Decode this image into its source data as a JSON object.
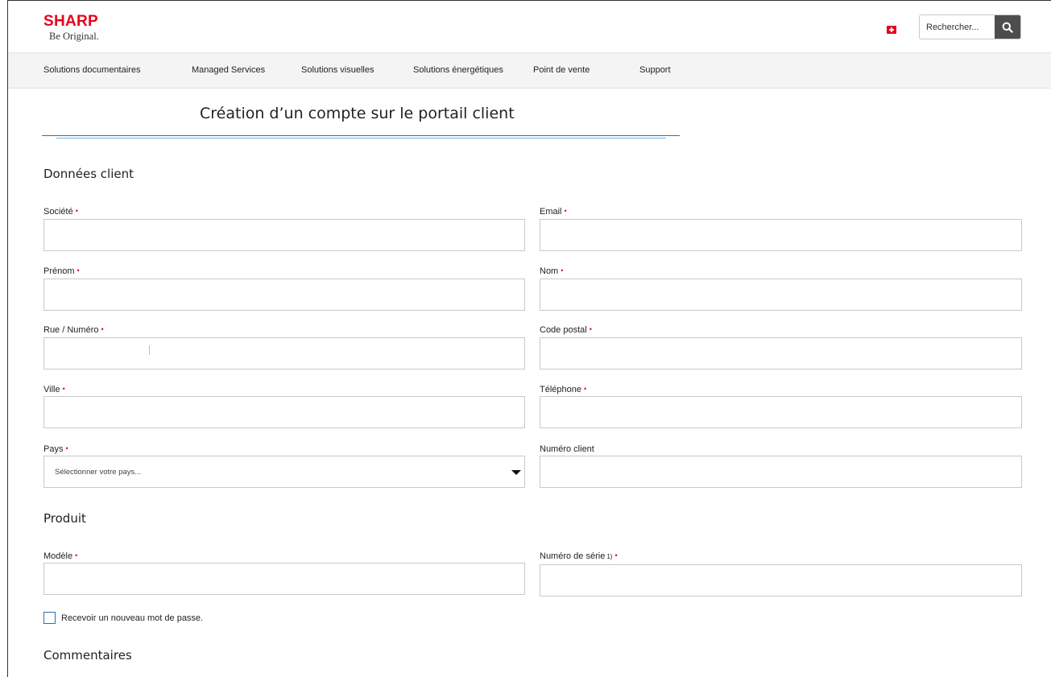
{
  "header": {
    "logo_mark": "SHARP",
    "logo_tagline": "Be Original.",
    "flag": "swiss-flag-icon",
    "search": {
      "placeholder": "Rechercher...",
      "icon": "search-icon"
    }
  },
  "nav": {
    "items": [
      {
        "label": "Solutions documentaires"
      },
      {
        "label": "Managed Services"
      },
      {
        "label": "Solutions visuelles"
      },
      {
        "label": "Solutions énergétiques"
      },
      {
        "label": "Point de vente"
      },
      {
        "label": "Support"
      }
    ]
  },
  "page": {
    "title": "Création d’un compte sur le portail client"
  },
  "sections": {
    "client": "Données client",
    "product": "Produit",
    "comments": "Commentaires"
  },
  "required_mark": "•",
  "fields": {
    "societe": {
      "label": "Société",
      "value": ""
    },
    "email": {
      "label": "Email",
      "value": ""
    },
    "prenom": {
      "label": "Prénom",
      "value": ""
    },
    "nom": {
      "label": "Nom",
      "value": ""
    },
    "rue": {
      "label": "Rue / Numéro",
      "value": ""
    },
    "code_postal": {
      "label": "Code postal",
      "value": ""
    },
    "ville": {
      "label": "Ville",
      "value": ""
    },
    "telephone": {
      "label": "Téléphone",
      "value": ""
    },
    "pays": {
      "label": "Pays",
      "selected": "Sélectionner votre pays..."
    },
    "numero_client": {
      "label": "Numéro client",
      "value": ""
    },
    "modele": {
      "label": "Modèle",
      "value": ""
    },
    "numero_serie": {
      "label": "Numéro de série",
      "footnote": "1)",
      "value": ""
    }
  },
  "options": {
    "new_password": {
      "label": "Recevoir un nouveau mot de passe.",
      "checked": false
    }
  },
  "colors": {
    "brand_red": "#e8001c",
    "nav_bg": "#f4f4f4",
    "rule_blue": "#2a6fb0",
    "rule_light_blue": "#6fb8e6",
    "search_button": "#4d4d4d"
  }
}
